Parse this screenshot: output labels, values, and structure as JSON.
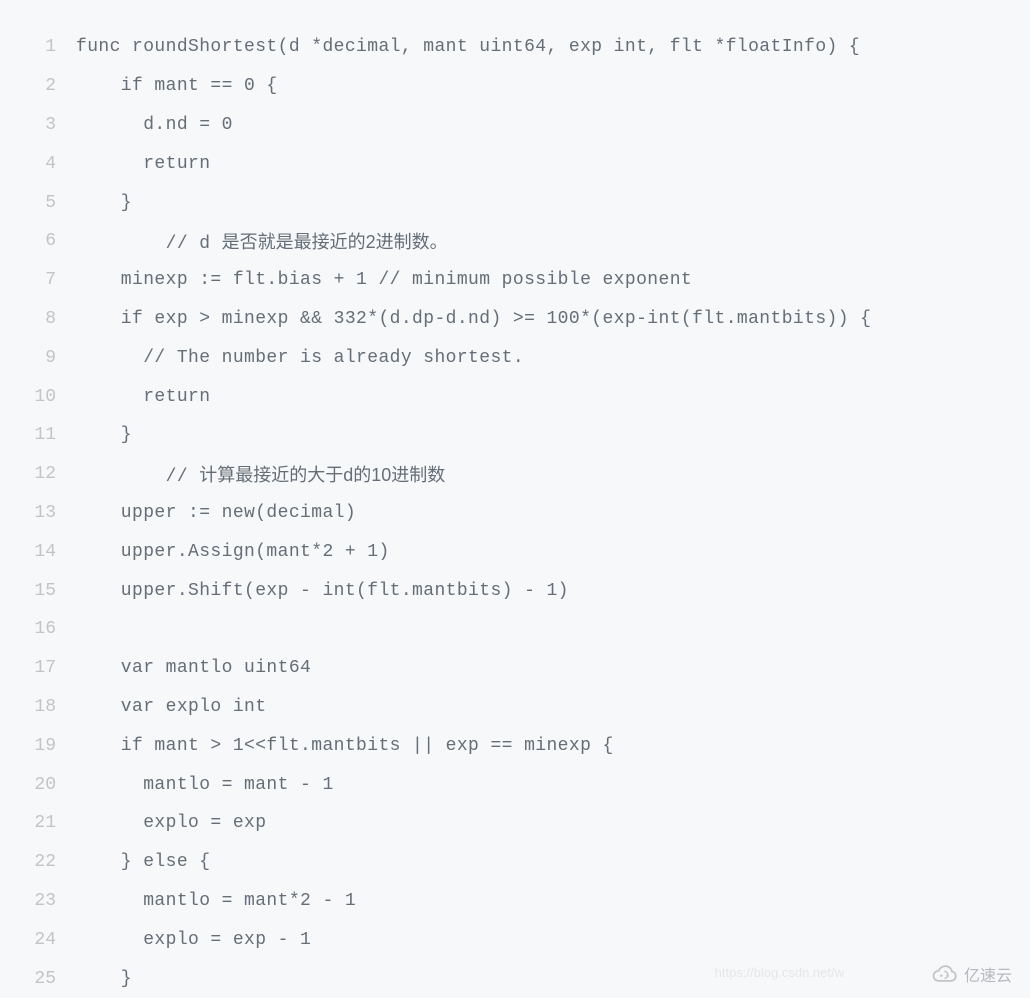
{
  "code": {
    "lines": [
      {
        "n": 1,
        "text": "func roundShortest(d *decimal, mant uint64, exp int, flt *floatInfo) {"
      },
      {
        "n": 2,
        "text": "    if mant == 0 {"
      },
      {
        "n": 3,
        "text": "      d.nd = 0"
      },
      {
        "n": 4,
        "text": "      return"
      },
      {
        "n": 5,
        "text": "    }"
      },
      {
        "n": 6,
        "text": "        // d ",
        "suffix_cjk": "是否就是最接近的2进制数。"
      },
      {
        "n": 7,
        "text": "    minexp := flt.bias + 1 // minimum possible exponent"
      },
      {
        "n": 8,
        "text": "    if exp > minexp && 332*(d.dp-d.nd) >= 100*(exp-int(flt.mantbits)) {"
      },
      {
        "n": 9,
        "text": "      // The number is already shortest."
      },
      {
        "n": 10,
        "text": "      return"
      },
      {
        "n": 11,
        "text": "    }"
      },
      {
        "n": 12,
        "text": "        // ",
        "suffix_cjk": "计算最接近的大于d的10进制数"
      },
      {
        "n": 13,
        "text": "    upper := new(decimal)"
      },
      {
        "n": 14,
        "text": "    upper.Assign(mant*2 + 1)"
      },
      {
        "n": 15,
        "text": "    upper.Shift(exp - int(flt.mantbits) - 1)"
      },
      {
        "n": 16,
        "text": ""
      },
      {
        "n": 17,
        "text": "    var mantlo uint64"
      },
      {
        "n": 18,
        "text": "    var explo int"
      },
      {
        "n": 19,
        "text": "    if mant > 1<<flt.mantbits || exp == minexp {"
      },
      {
        "n": 20,
        "text": "      mantlo = mant - 1"
      },
      {
        "n": 21,
        "text": "      explo = exp"
      },
      {
        "n": 22,
        "text": "    } else {"
      },
      {
        "n": 23,
        "text": "      mantlo = mant*2 - 1"
      },
      {
        "n": 24,
        "text": "      explo = exp - 1"
      },
      {
        "n": 25,
        "text": "    }"
      }
    ]
  },
  "watermark": {
    "url": "https://blog.csdn.net/w",
    "brand": "亿速云"
  }
}
